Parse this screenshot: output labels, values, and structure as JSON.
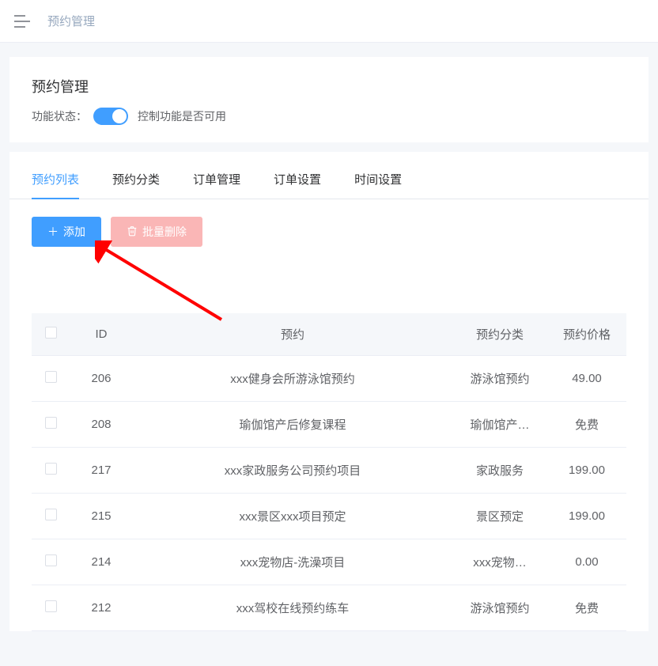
{
  "header": {
    "breadcrumb": "预约管理"
  },
  "settings": {
    "title": "预约管理",
    "statusLabel": "功能状态：",
    "switchOn": true,
    "hint": "控制功能是否可用"
  },
  "tabs": [
    {
      "label": "预约列表",
      "active": true
    },
    {
      "label": "预约分类",
      "active": false
    },
    {
      "label": "订单管理",
      "active": false
    },
    {
      "label": "订单设置",
      "active": false
    },
    {
      "label": "时间设置",
      "active": false
    }
  ],
  "toolbar": {
    "add": "添加",
    "batchDelete": "批量删除"
  },
  "table": {
    "columns": {
      "id": "ID",
      "name": "预约",
      "category": "预约分类",
      "price": "预约价格"
    },
    "rows": [
      {
        "id": "206",
        "name": "xxx健身会所游泳馆预约",
        "category": "游泳馆预约",
        "price": "49.00"
      },
      {
        "id": "208",
        "name": "瑜伽馆产后修复课程",
        "category": "瑜伽馆产…",
        "price": "免费"
      },
      {
        "id": "217",
        "name": "xxx家政服务公司预约项目",
        "category": "家政服务",
        "price": "199.00"
      },
      {
        "id": "215",
        "name": "xxx景区xxx项目预定",
        "category": "景区预定",
        "price": "199.00"
      },
      {
        "id": "214",
        "name": "xxx宠物店-洗澡项目",
        "category": "xxx宠物…",
        "price": "0.00"
      },
      {
        "id": "212",
        "name": "xxx驾校在线预约练车",
        "category": "游泳馆预约",
        "price": "免费"
      }
    ]
  },
  "annotationArrowColor": "#ff0000"
}
